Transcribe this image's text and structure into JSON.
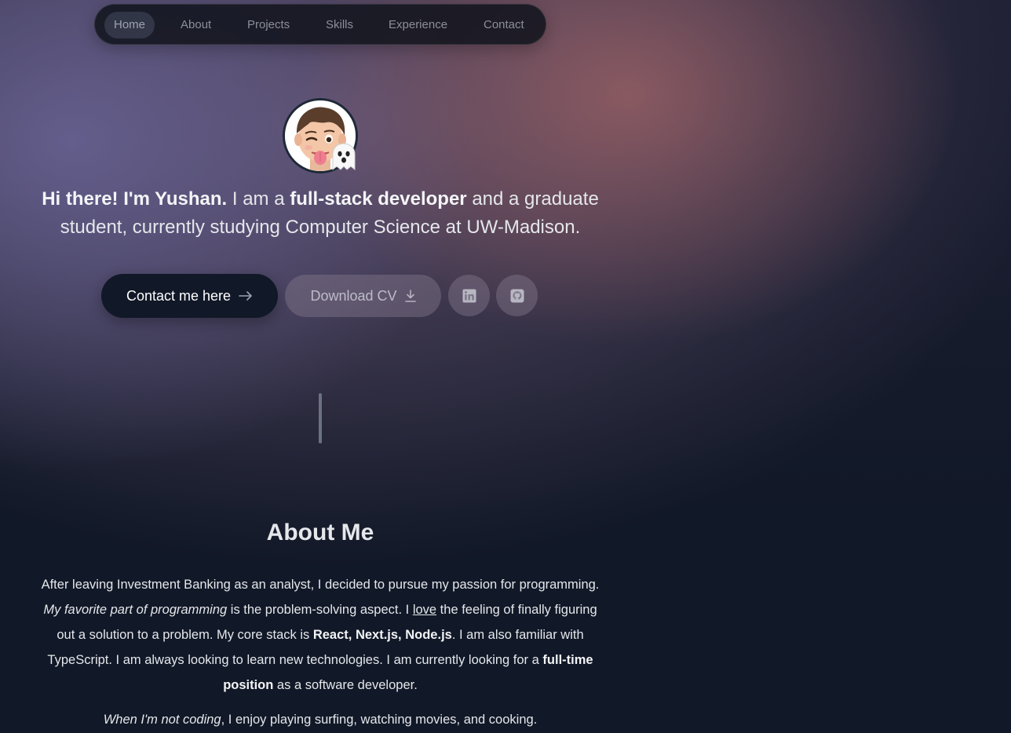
{
  "nav": {
    "items": [
      {
        "label": "Home",
        "active": true
      },
      {
        "label": "About",
        "active": false
      },
      {
        "label": "Projects",
        "active": false
      },
      {
        "label": "Skills",
        "active": false
      },
      {
        "label": "Experience",
        "active": false
      },
      {
        "label": "Contact",
        "active": false
      }
    ]
  },
  "hero": {
    "greeting": "Hi there! I'm Yushan.",
    "text_1": " I am a ",
    "role": "full-stack developer",
    "text_2": " and a graduate student, currently studying Computer Science at UW-Madison.",
    "avatar_badge_icon": "ghost-emoji"
  },
  "buttons": {
    "contact_label": "Contact me here",
    "contact_icon": "arrow-right-icon",
    "cv_label": "Download CV",
    "cv_icon": "download-icon",
    "linkedin_icon": "linkedin-icon",
    "github_icon": "github-icon"
  },
  "about": {
    "title": "About Me",
    "p1_a": "After leaving Investment Banking as an analyst, I decided to pursue my passion for programming. ",
    "p1_em": "My favorite part of programming",
    "p1_b": " is the problem-solving aspect. I ",
    "p1_love": "love",
    "p1_c": " the feeling of finally figuring out a solution to a problem. My core stack is ",
    "p1_stack": "React, Next.js, Node.js",
    "p1_d": ". I am also familiar with TypeScript. I am always looking to learn new technologies. I am currently looking for a ",
    "p1_position": "full-time position",
    "p1_e": " as a software developer.",
    "p2_em": "When I'm not coding",
    "p2_rest": ", I enjoy playing surfing, watching movies, and cooking."
  },
  "colors": {
    "primary_button": "#111827",
    "background_dark": "#111827"
  }
}
